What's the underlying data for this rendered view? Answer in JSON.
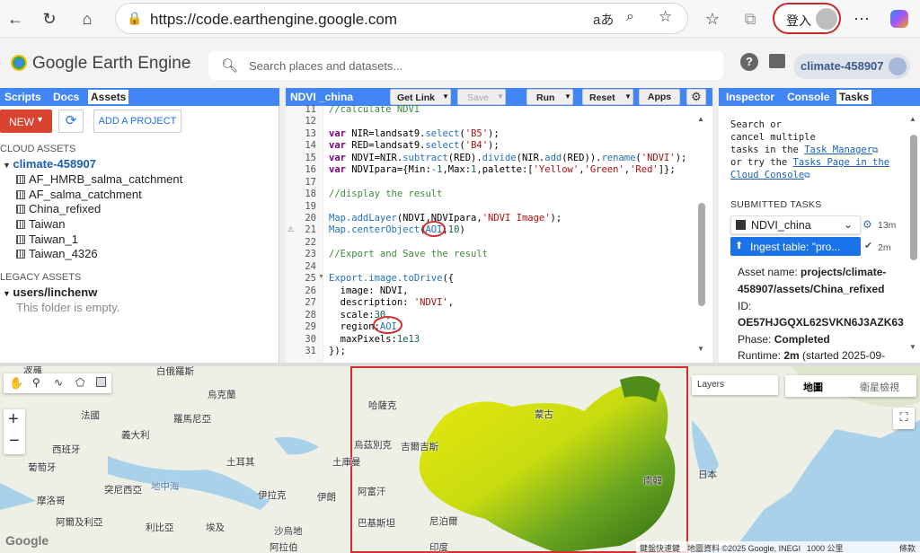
{
  "browser": {
    "url": "https://code.earthengine.google.com",
    "signin_label": "登入"
  },
  "header": {
    "app_name": "Google Earth Engine",
    "search_placeholder": "Search places and datasets...",
    "project": "climate-458907"
  },
  "left_panel": {
    "tabs": [
      "Scripts",
      "Docs",
      "Assets"
    ],
    "active_tab": "Assets",
    "new_label": "NEW",
    "add_project_label": "ADD A PROJECT",
    "cloud_assets_title": "CLOUD ASSETS",
    "cloud_project": "climate-458907",
    "assets": [
      "AF_HMRB_salma_catchment",
      "AF_salma_catchment",
      "China_refixed",
      "Taiwan",
      "Taiwan_1",
      "Taiwan_4326"
    ],
    "legacy_title": "LEGACY ASSETS",
    "legacy_user": "users/linchenw",
    "empty_msg": "This folder is empty."
  },
  "editor": {
    "script_name": "NDVI _china",
    "buttons": [
      "Get Link",
      "Save",
      "Run",
      "Reset",
      "Apps"
    ],
    "line_numbers": [
      "11",
      "12",
      "13",
      "14",
      "15",
      "16",
      "17",
      "18",
      "19",
      "20",
      "21",
      "22",
      "23",
      "24",
      "25",
      "26",
      "27",
      "28",
      "29",
      "30",
      "31"
    ]
  },
  "right_panel": {
    "tabs": [
      "Inspector",
      "Console",
      "Tasks"
    ],
    "active_tab": "Tasks",
    "intro_1": "Search or",
    "intro_2": "cancel multiple",
    "intro_3a": "tasks in the ",
    "intro_3b": "Task Manager",
    "intro_4a": "or try the ",
    "intro_4b": "Tasks Page in the",
    "intro_5": "Cloud Console",
    "submitted_title": "SUBMITTED TASKS",
    "task1_name": "NDVI_china",
    "task1_time": "13m",
    "task2_name": "Ingest table: \"pro...",
    "task2_time": "2m",
    "asset_label": "Asset name: ",
    "asset_value_1": "projects/climate-",
    "asset_value_2": "458907/assets/China_refixed",
    "id_label": "ID:",
    "id_value": "OE57HJGQXL62SVKN6J3AZK63",
    "phase_label": "Phase: ",
    "phase_value": "Completed",
    "runtime_label": "Runtime: ",
    "runtime_value": "2m",
    "runtime_rest": " (started 2025-09-"
  },
  "map": {
    "layers_label": "Layers",
    "map_type": "地圖",
    "satellite_type": "衛星檢視",
    "labels": [
      "波羅",
      "白俄羅斯",
      "烏克蘭",
      "法國",
      "羅馬尼亞",
      "義大利",
      "西班牙",
      "土耳其",
      "土庫曼",
      "葡萄牙",
      "地中海",
      "伊拉克",
      "伊朗",
      "阿富汗",
      "哈薩克",
      "烏茲別克",
      "吉爾吉斯",
      "蒙古",
      "突尼西亞",
      "摩洛哥",
      "阿爾及利亞",
      "利比亞",
      "埃及",
      "沙烏地",
      "阿拉伯",
      "巴基斯坦",
      "尼泊爾",
      "印度",
      "日本",
      "南韓"
    ],
    "footer_1": "鍵盤快速鍵",
    "footer_2": "地圖資料 ©2025 Google, INEGI",
    "footer_3": "1000 公里",
    "footer_4": "條款",
    "google_mark": "Google"
  }
}
